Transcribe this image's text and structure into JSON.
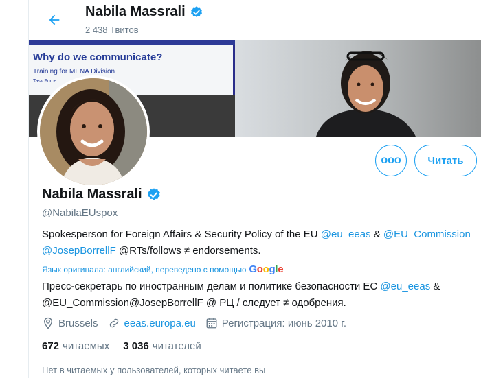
{
  "header": {
    "name": "Nabila Massrali",
    "tweet_count": "2 438 Твитов"
  },
  "banner": {
    "slide_title": "Why do we communicate?",
    "slide_subtitle": "Training for MENA Division",
    "slide_caption": "Task Force"
  },
  "actions": {
    "more_label": "ooo",
    "follow_label": "Читать"
  },
  "profile": {
    "name": "Nabila Massrali",
    "handle": "@NabilaEUspox",
    "bio": {
      "text1": "Spokesperson for Foreign Affairs & Security Policy of the EU ",
      "link1": "@eu_eeas",
      "text2": " & ",
      "link2": "@EU_Commission",
      "text3": " ",
      "link3": "@JosepBorrellF",
      "text4": " @RTs/follows ≠ endorsements."
    },
    "translation_note": "Язык оригинала: английский, переведено с помощью",
    "google": [
      "G",
      "o",
      "o",
      "g",
      "l",
      "e"
    ],
    "bio_translated": {
      "text1": "Пресс-секретарь по иностранным делам и политике безопасности ЕС ",
      "link1": "@eu_eeas",
      "text2": " & @EU_Commission@JosepBorrellF @ РЦ / следует ≠ одобрения."
    },
    "location": "Brussels",
    "website": "eeas.europa.eu",
    "joined": "Регистрация: июнь 2010 г."
  },
  "stats": {
    "following_count": "672",
    "following_label": "читаемых",
    "followers_count": "3 036",
    "followers_label": "читателей"
  },
  "footnote": "Нет в читаемых у пользователей, которых читаете вы",
  "colors": {
    "accent": "#1da1f2",
    "verified": "#1da1f2",
    "secondary_text": "#657786"
  },
  "icons": [
    "back-arrow-icon",
    "verified-badge-icon",
    "location-pin-icon",
    "link-icon",
    "calendar-icon",
    "more-icon"
  ]
}
